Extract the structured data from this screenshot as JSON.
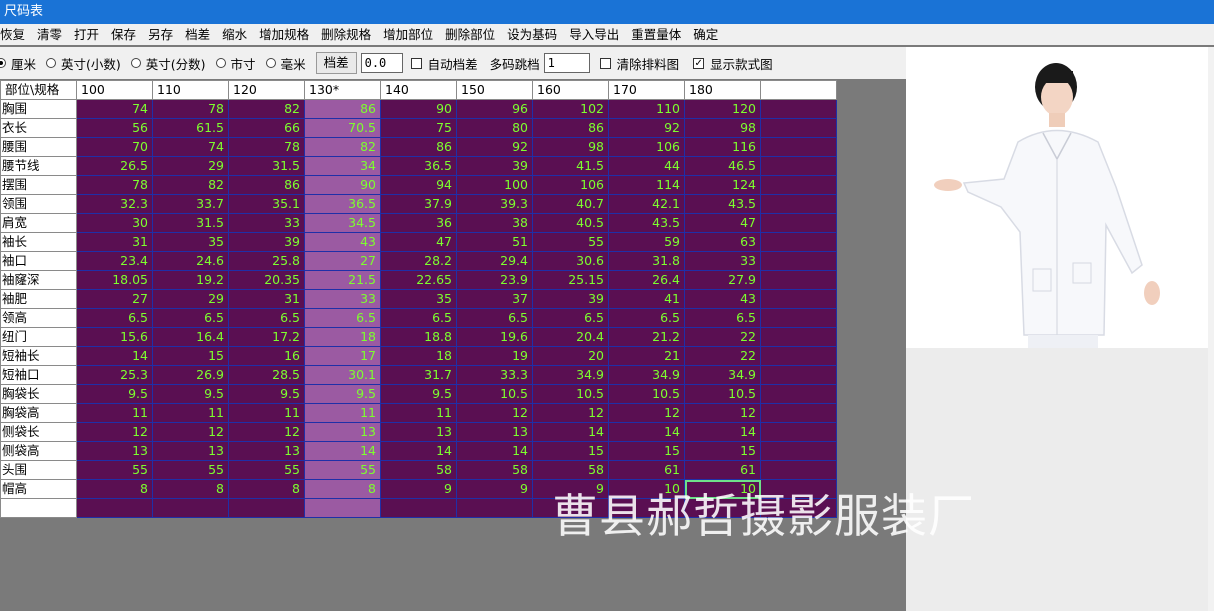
{
  "window": {
    "title": "尺码表"
  },
  "menu": [
    "恢复",
    "清零",
    "打开",
    "保存",
    "另存",
    "档差",
    "缩水",
    "增加规格",
    "删除规格",
    "增加部位",
    "删除部位",
    "设为基码",
    "导入导出",
    "重置量体",
    "确定"
  ],
  "toolbar": {
    "units": [
      {
        "label": "厘米",
        "checked": true
      },
      {
        "label": "英寸(小数)",
        "checked": false
      },
      {
        "label": "英寸(分数)",
        "checked": false
      },
      {
        "label": "市寸",
        "checked": false
      },
      {
        "label": "毫米",
        "checked": false
      }
    ],
    "grade_button": "档差",
    "grade_value": "0.0",
    "auto_grade_label": "自动档差",
    "auto_grade_checked": false,
    "multi_jump_label": "多码跳档",
    "multi_jump_value": "1",
    "clear_layout_label": "清除排料图",
    "clear_layout_checked": false,
    "show_style_label": "显示款式图",
    "show_style_checked": true,
    "check_mark": "✓"
  },
  "table": {
    "corner": "部位\\规格",
    "sizes": [
      "100",
      "110",
      "120",
      "130*",
      "140",
      "150",
      "160",
      "170",
      "180",
      ""
    ],
    "base_index": 3,
    "rows": [
      {
        "part": "胸围",
        "values": [
          "74",
          "78",
          "82",
          "86",
          "90",
          "96",
          "102",
          "110",
          "120"
        ]
      },
      {
        "part": "衣长",
        "values": [
          "56",
          "61.5",
          "66",
          "70.5",
          "75",
          "80",
          "86",
          "92",
          "98"
        ]
      },
      {
        "part": "腰围",
        "values": [
          "70",
          "74",
          "78",
          "82",
          "86",
          "92",
          "98",
          "106",
          "116"
        ]
      },
      {
        "part": "腰节线",
        "values": [
          "26.5",
          "29",
          "31.5",
          "34",
          "36.5",
          "39",
          "41.5",
          "44",
          "46.5"
        ]
      },
      {
        "part": "摆围",
        "values": [
          "78",
          "82",
          "86",
          "90",
          "94",
          "100",
          "106",
          "114",
          "124"
        ]
      },
      {
        "part": "领围",
        "values": [
          "32.3",
          "33.7",
          "35.1",
          "36.5",
          "37.9",
          "39.3",
          "40.7",
          "42.1",
          "43.5"
        ]
      },
      {
        "part": "肩宽",
        "values": [
          "30",
          "31.5",
          "33",
          "34.5",
          "36",
          "38",
          "40.5",
          "43.5",
          "47"
        ]
      },
      {
        "part": "袖长",
        "values": [
          "31",
          "35",
          "39",
          "43",
          "47",
          "51",
          "55",
          "59",
          "63"
        ]
      },
      {
        "part": "袖口",
        "values": [
          "23.4",
          "24.6",
          "25.8",
          "27",
          "28.2",
          "29.4",
          "30.6",
          "31.8",
          "33"
        ]
      },
      {
        "part": "袖窿深",
        "values": [
          "18.05",
          "19.2",
          "20.35",
          "21.5",
          "22.65",
          "23.9",
          "25.15",
          "26.4",
          "27.9"
        ]
      },
      {
        "part": "袖肥",
        "values": [
          "27",
          "29",
          "31",
          "33",
          "35",
          "37",
          "39",
          "41",
          "43"
        ]
      },
      {
        "part": "领高",
        "values": [
          "6.5",
          "6.5",
          "6.5",
          "6.5",
          "6.5",
          "6.5",
          "6.5",
          "6.5",
          "6.5"
        ]
      },
      {
        "part": "纽门",
        "values": [
          "15.6",
          "16.4",
          "17.2",
          "18",
          "18.8",
          "19.6",
          "20.4",
          "21.2",
          "22"
        ]
      },
      {
        "part": "短袖长",
        "values": [
          "14",
          "15",
          "16",
          "17",
          "18",
          "19",
          "20",
          "21",
          "22"
        ]
      },
      {
        "part": "短袖口",
        "values": [
          "25.3",
          "26.9",
          "28.5",
          "30.1",
          "31.7",
          "33.3",
          "34.9",
          "34.9",
          "34.9"
        ]
      },
      {
        "part": "胸袋长",
        "values": [
          "9.5",
          "9.5",
          "9.5",
          "9.5",
          "9.5",
          "10.5",
          "10.5",
          "10.5",
          "10.5"
        ]
      },
      {
        "part": "胸袋高",
        "values": [
          "11",
          "11",
          "11",
          "11",
          "11",
          "12",
          "12",
          "12",
          "12"
        ]
      },
      {
        "part": "侧袋长",
        "values": [
          "12",
          "12",
          "12",
          "13",
          "13",
          "13",
          "14",
          "14",
          "14"
        ]
      },
      {
        "part": "侧袋高",
        "values": [
          "13",
          "13",
          "13",
          "14",
          "14",
          "14",
          "15",
          "15",
          "15"
        ]
      },
      {
        "part": "头围",
        "values": [
          "55",
          "55",
          "55",
          "55",
          "58",
          "58",
          "58",
          "61",
          "61"
        ]
      },
      {
        "part": "帽高",
        "values": [
          "8",
          "8",
          "8",
          "8",
          "9",
          "9",
          "9",
          "10",
          "10"
        ]
      },
      {
        "part": "",
        "values": [
          "",
          "",
          "",
          "",
          "",
          "",
          "",
          "",
          ""
        ]
      }
    ],
    "selected_cell": {
      "row": 20,
      "col": 8
    }
  },
  "watermark": "曹县郝哲摄影服装厂",
  "colors": {
    "title_bar": "#1a73d6",
    "cell_bg": "#5a0f52",
    "base_col_bg": "#9b5aa2",
    "cell_text": "#7dff2e",
    "grid_line": "#1f2fa8"
  }
}
